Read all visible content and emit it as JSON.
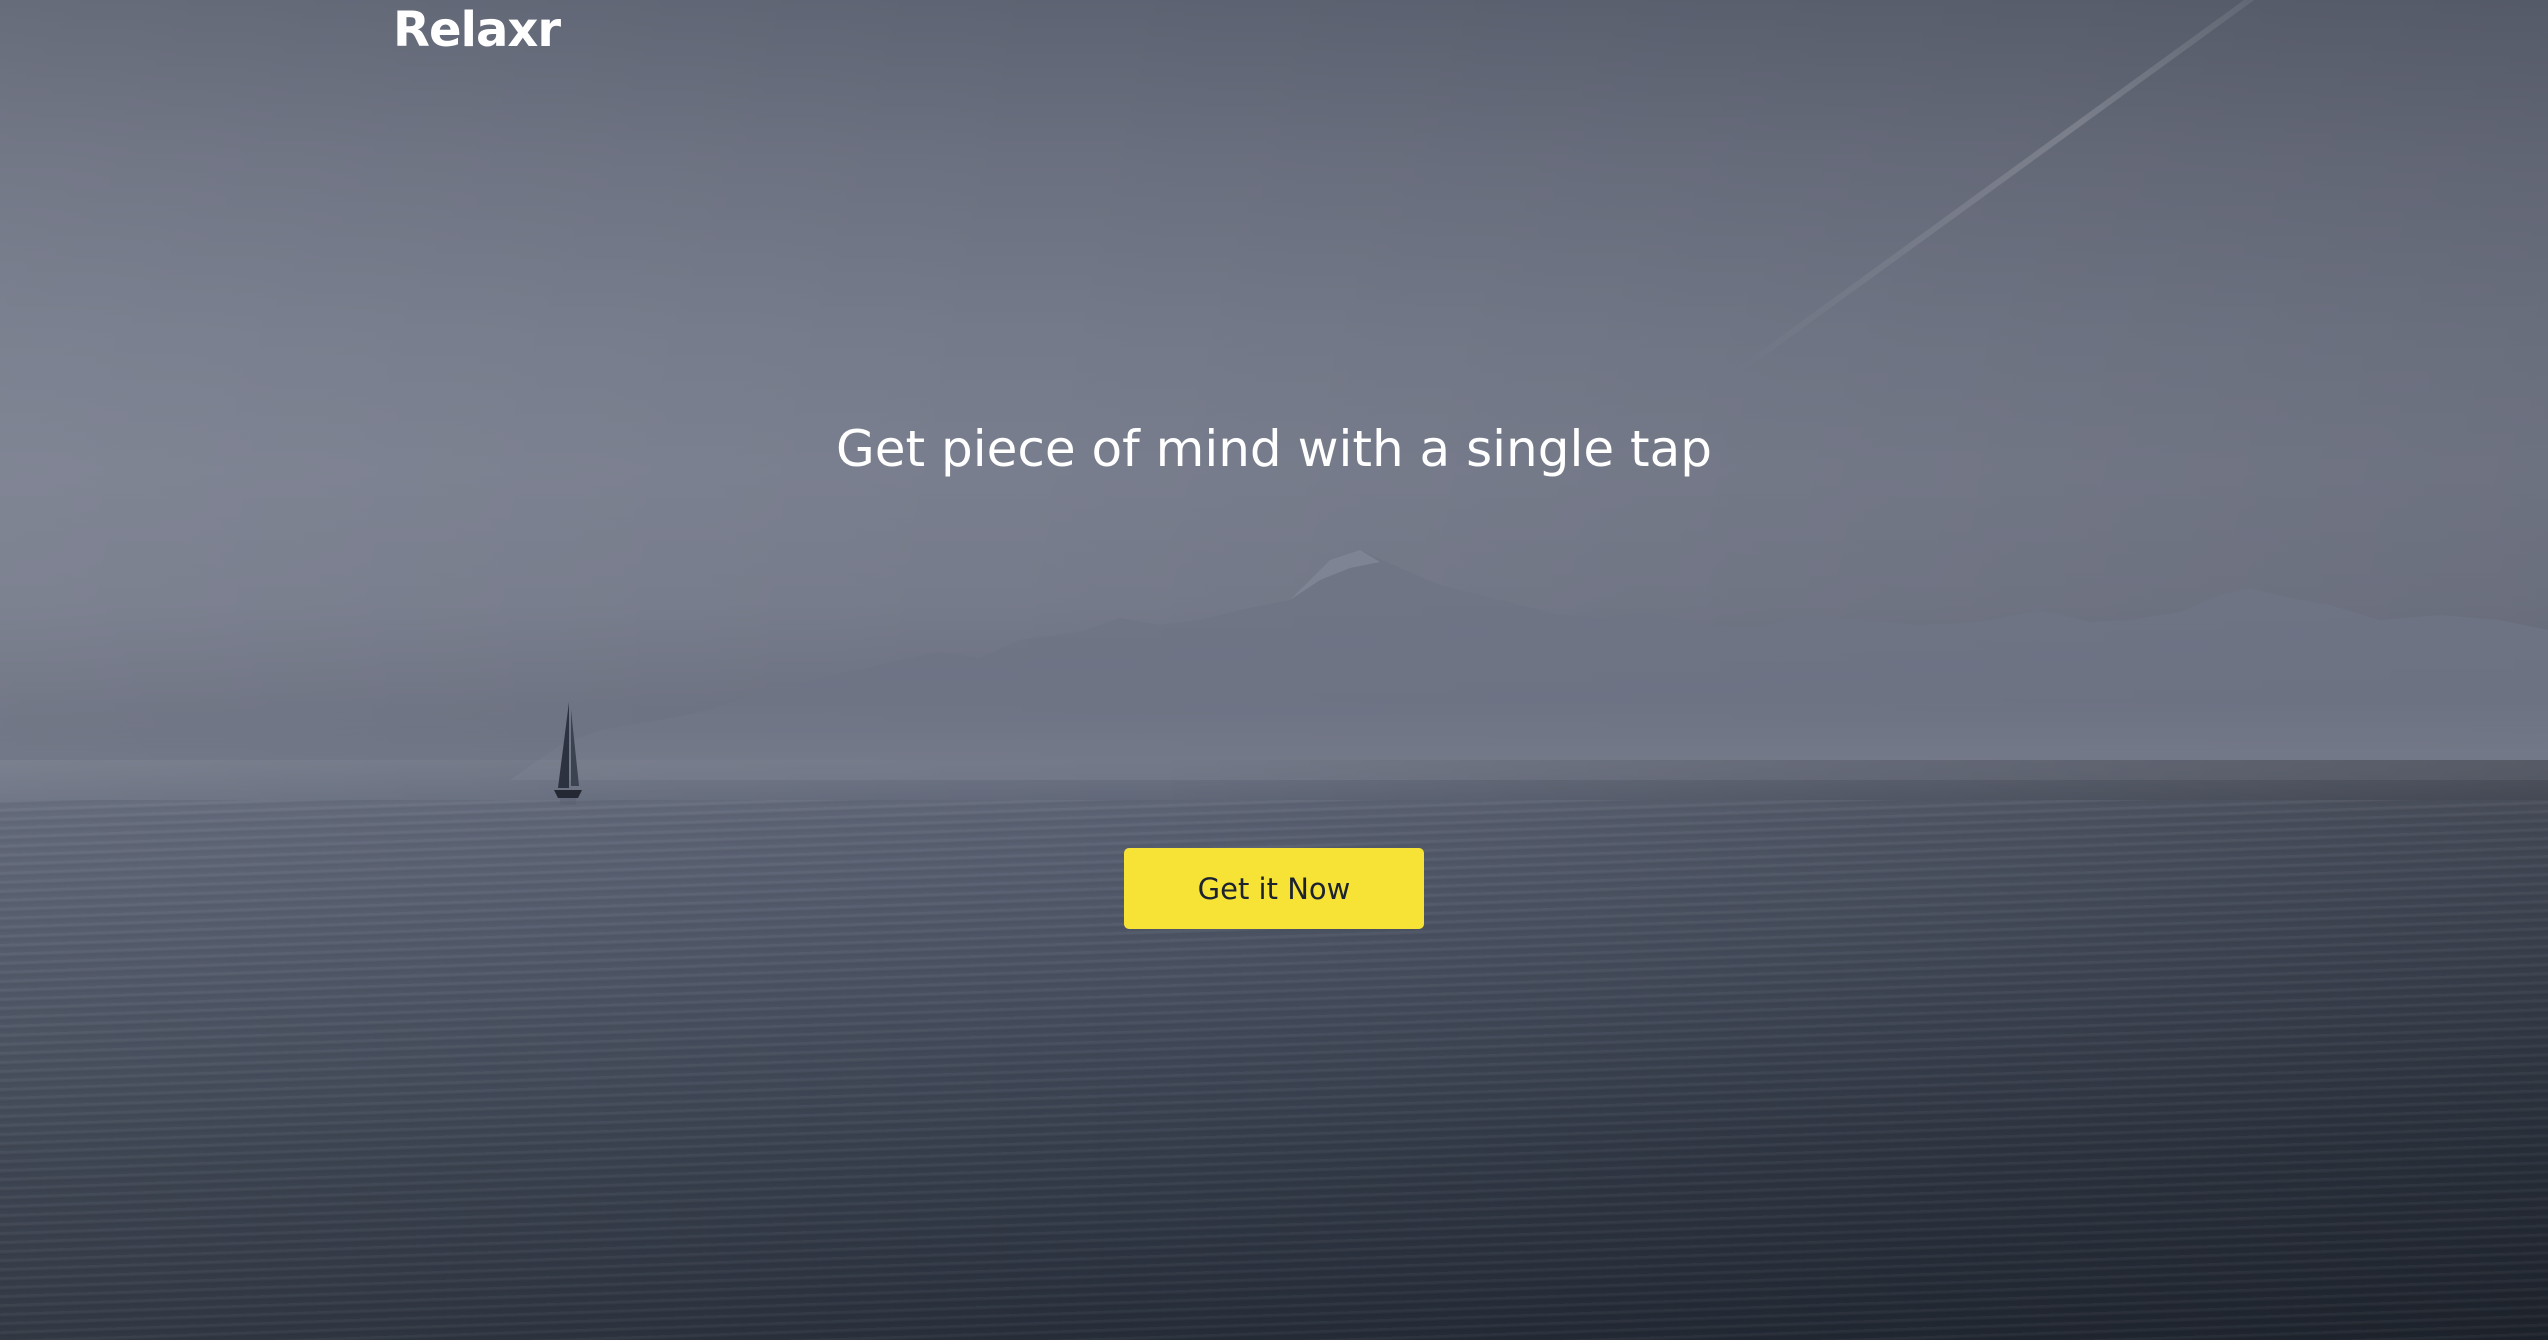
{
  "brand": {
    "name": "Relaxr"
  },
  "hero": {
    "headline": "Get piece of mind with a single tap",
    "background": "misty-sea-mountains-sailboat-photo"
  },
  "cta": {
    "label": "Get it Now",
    "color": "#f7e336",
    "text_color": "#1c2230"
  },
  "colors": {
    "text_primary": "#ffffff"
  }
}
